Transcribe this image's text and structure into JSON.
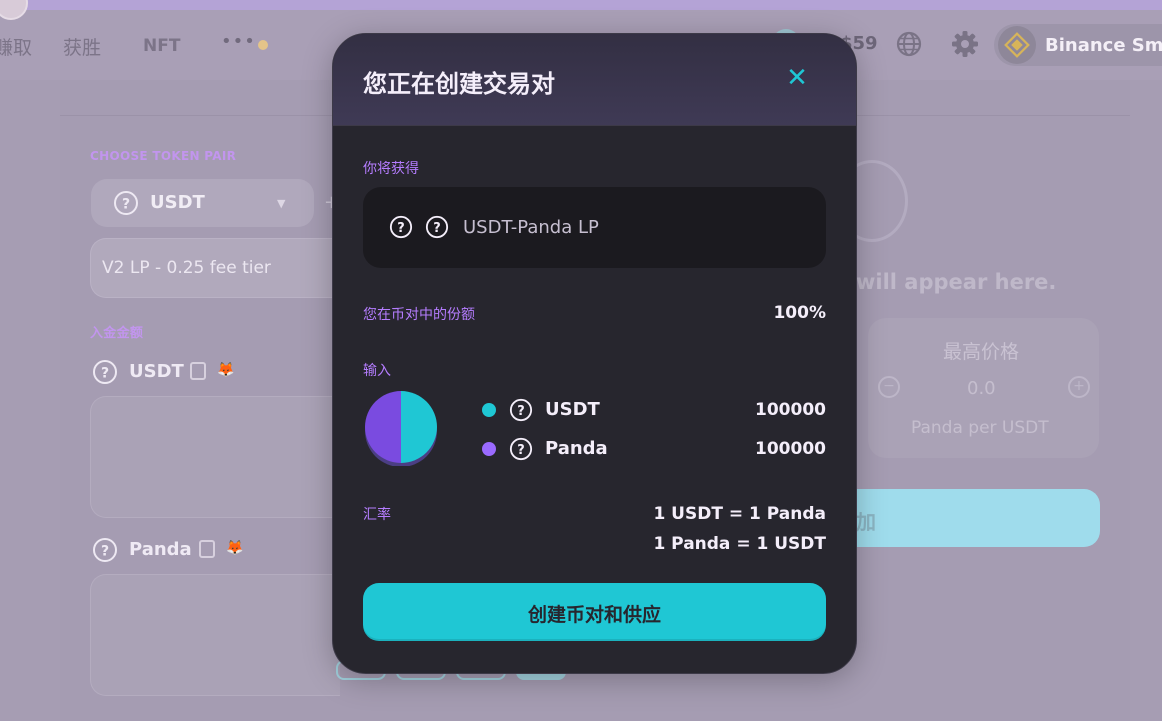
{
  "nav": {
    "items": [
      "赚取",
      "获胜",
      "NFT"
    ],
    "more": "•••",
    "price": "$59",
    "network": "Binance Sma"
  },
  "background": {
    "choose_token_pair": "CHOOSE TOKEN PAIR",
    "token_a": "USDT",
    "fee_tier": "V2 LP - 0.25 fee tier",
    "deposit_amount": "入金金额",
    "deposit_token_a": "USDT",
    "deposit_token_b": "Panda",
    "appear_text": "will appear here.",
    "max_price_title": "最高价格",
    "max_price_value": "0.0",
    "max_price_unit": "Panda per USDT",
    "add_button": "加"
  },
  "modal": {
    "title": "您正在创建交易对",
    "close_icon": "close-icon",
    "you_receive_label": "你将获得",
    "lp_token": "USDT-Panda LP",
    "share_label": "您在币对中的份额",
    "share_value": "100%",
    "input_label": "输入",
    "inputs": [
      {
        "token": "USDT",
        "amount": "100000",
        "color": "#1fc7d4"
      },
      {
        "token": "Panda",
        "amount": "100000",
        "color": "#9a6aff"
      }
    ],
    "pie_share": [
      0.5,
      0.5
    ],
    "rate_label": "汇率",
    "rate_1": "1 USDT = 1 Panda",
    "rate_2": "1 Panda = 1 USDT",
    "cta": "创建币对和供应"
  },
  "colors": {
    "accent": "#1fc7d4",
    "secondary": "#9a6aff",
    "label": "#b57dff",
    "modal_bg": "#27262e"
  }
}
